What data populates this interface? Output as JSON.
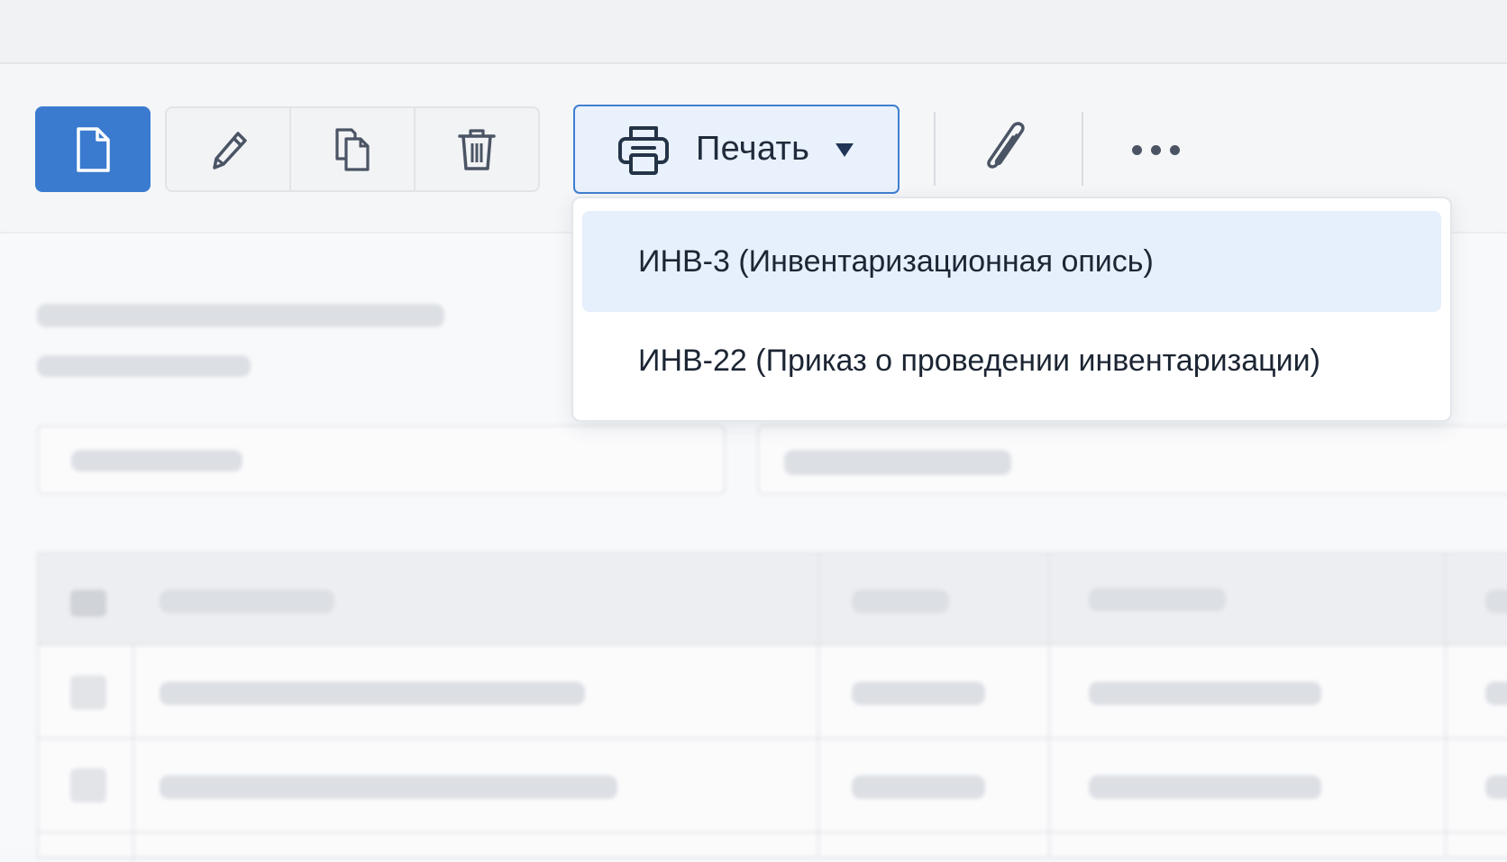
{
  "toolbar": {
    "new_icon": "document-icon",
    "edit_icon": "pencil-icon",
    "copy_icon": "copy-icon",
    "delete_icon": "trash-icon",
    "print_icon": "printer-icon",
    "print_label": "Печать",
    "caret_icon": "caret-down-icon",
    "attach_icon": "paperclip-icon",
    "more_icon": "more-dots-icon"
  },
  "print_menu": {
    "items": [
      {
        "label": "ИНВ-3 (Инвентаризационная опись)",
        "highlighted": true
      },
      {
        "label": "ИНВ-22 (Приказ о проведении инвентаризации)",
        "highlighted": false
      }
    ]
  },
  "colors": {
    "primary": "#3a7bd0",
    "highlight": "#e6effc",
    "text": "#1c2533"
  }
}
